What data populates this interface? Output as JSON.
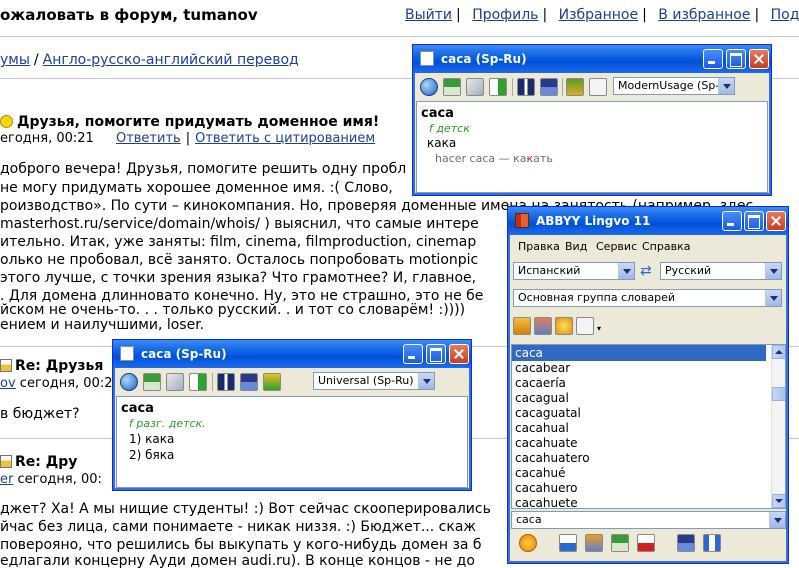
{
  "forum": {
    "welcome": "ожаловать в форум, tumanov",
    "nav": [
      "Выйти",
      "Профиль",
      "Избранное",
      "В избранное",
      "Под"
    ],
    "breadcrumb": {
      "first": "умы",
      "second": "Англо-русско-английский перевод"
    },
    "post1": {
      "title": "Друзья, помогите придумать доменное имя!",
      "date": "егодня, 00:21",
      "reply": "Ответить",
      "quote": "Ответить с цитированием"
    },
    "body_lines": [
      "доброго вечера! Друзья, помогите решить одну пробл",
      "не могу придумать хорошее доменное имя. :( Слово,",
      "роизводство». По сути – кинокомпания. Но, проверяя доменные имена на занятость (например, здес",
      "masterhost.ru/service/domain/whois/ ) выяснил, что самые интере",
      "ительно. Итак, уже заняты: film, cinema, filmproduction, cinemap",
      "олько не пробовал, всё занято. Осталось попробовать motionpic",
      "этого лучше, с точки зрения языка? Что грамотнее? И, главное,",
      ". Для домена длинновато конечно. Ну, это не страшно, это не бе",
      "йском не очень-то. . . только русский. . и тот со словарём! :))))",
      "ением и наилучшими, loser."
    ],
    "post2": {
      "title": "Re: Друзья",
      "author": "ov",
      "date": "сегодня, 00:2"
    },
    "post2_body": "в бюджет?",
    "post3": {
      "title": "Re: Дру",
      "author": "er",
      "date": "сегодня, 00:"
    },
    "post3_body": [
      "джет? Ха! А мы нищие студенты! :) Вот сейчас скооперировались",
      "йчас без лица, сами понимаете - никак низзя. :) Бюджет... скаж",
      "поверояно, что решились бы выкупать у кого-нибудь домен за б",
      "едлагали концерну Ауди домен audi.ru). В конце концов - не до"
    ]
  },
  "popup_top": {
    "title": "caca (Sp-Ru)",
    "dict": "ModernUsage (Sp-Ru)",
    "headword": "caca",
    "gram": "f детск",
    "translation": "кака",
    "example_pre": "hacer caca — ка",
    "example_accent": "к",
    "example_post": "ать"
  },
  "popup_mid": {
    "title": "caca (Sp-Ru)",
    "dict": "Universal (Sp-Ru)",
    "headword": "caca",
    "gram": "f разг. детск.",
    "t1": "1) кака",
    "t2": "2) бяка"
  },
  "lingvo": {
    "title": "ABBYY Lingvo 11",
    "menu": [
      "Правка",
      "Вид",
      "Сервис",
      "Справка"
    ],
    "lang_from": "Испанский",
    "lang_to": "Русский",
    "group": "Основная группа словарей",
    "words": [
      "caca",
      "cacabear",
      "cacaería",
      "cacagual",
      "cacaguatal",
      "cacahual",
      "cacahuate",
      "cacahuatero",
      "cacahué",
      "cacahuero",
      "cacahuete"
    ],
    "search": "caca"
  },
  "colors": {
    "titlebar": "#0a5fe0",
    "selection": "#316ac5",
    "link": "#1c3e9e",
    "grammar": "#2a9a2a"
  }
}
